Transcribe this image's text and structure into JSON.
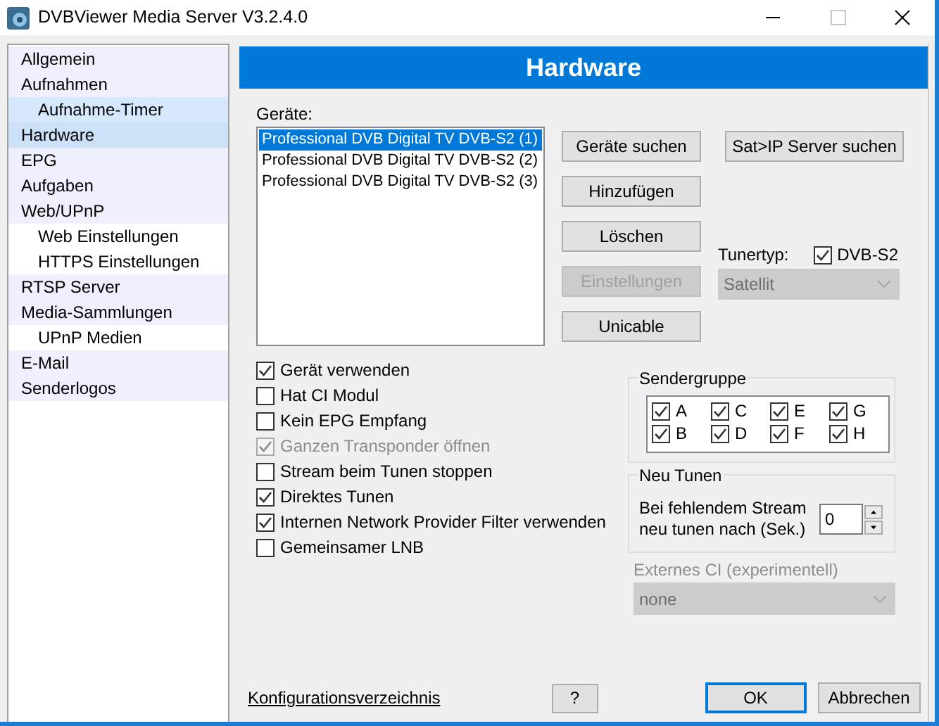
{
  "window": {
    "title": "DVBViewer Media Server V3.2.4.0",
    "maximize_enabled": false
  },
  "sidebar": {
    "items": [
      {
        "label": "Allgemein",
        "selected": false,
        "hovered": false
      },
      {
        "label": "Aufnahmen",
        "selected": false,
        "hovered": false,
        "children": [
          {
            "label": "Aufnahme-Timer",
            "selected": false,
            "hovered": true
          }
        ]
      },
      {
        "label": "Hardware",
        "selected": true,
        "hovered": false
      },
      {
        "label": "EPG",
        "selected": false,
        "hovered": false
      },
      {
        "label": "Aufgaben",
        "selected": false,
        "hovered": false
      },
      {
        "label": "Web/UPnP",
        "selected": false,
        "hovered": false,
        "children": [
          {
            "label": "Web Einstellungen",
            "selected": false,
            "hovered": false
          },
          {
            "label": "HTTPS Einstellungen",
            "selected": false,
            "hovered": false
          }
        ]
      },
      {
        "label": "RTSP Server",
        "selected": false,
        "hovered": false
      },
      {
        "label": "Media-Sammlungen",
        "selected": false,
        "hovered": false,
        "children": [
          {
            "label": "UPnP Medien",
            "selected": false,
            "hovered": false
          }
        ]
      },
      {
        "label": "E-Mail",
        "selected": false,
        "hovered": false
      },
      {
        "label": "Senderlogos",
        "selected": false,
        "hovered": false
      }
    ]
  },
  "page_title": "Hardware",
  "devices": {
    "label": "Geräte:",
    "items": [
      {
        "text": "Professional DVB Digital TV DVB-S2 (1)",
        "selected": true
      },
      {
        "text": "Professional DVB Digital TV DVB-S2 (2)",
        "selected": false
      },
      {
        "text": "Professional DVB Digital TV DVB-S2 (3)",
        "selected": false
      }
    ]
  },
  "device_buttons": [
    {
      "label": "Geräte suchen",
      "disabled": false
    },
    {
      "label": "Hinzufügen",
      "disabled": false
    },
    {
      "label": "Löschen",
      "disabled": false
    },
    {
      "label": "Einstellungen",
      "disabled": true
    },
    {
      "label": "Unicable",
      "disabled": false
    }
  ],
  "sat_ip_button": {
    "label": "Sat>IP Server suchen"
  },
  "tuner": {
    "label": "Tunertyp:",
    "dvb_s2": {
      "label": "DVB-S2",
      "checked": true
    },
    "select": {
      "value": "Satellit",
      "disabled": true
    }
  },
  "options": [
    {
      "label": "Gerät verwenden",
      "checked": true,
      "disabled": false
    },
    {
      "label": "Hat CI Modul",
      "checked": false,
      "disabled": false
    },
    {
      "label": "Kein EPG Empfang",
      "checked": false,
      "disabled": false
    },
    {
      "label": "Ganzen Transponder öffnen",
      "checked": true,
      "disabled": true
    },
    {
      "label": "Stream beim Tunen stoppen",
      "checked": false,
      "disabled": false
    },
    {
      "label": "Direktes Tunen",
      "checked": true,
      "disabled": false
    },
    {
      "label": "Internen Network Provider Filter verwenden",
      "checked": true,
      "disabled": false
    },
    {
      "label": "Gemeinsamer LNB",
      "checked": false,
      "disabled": false
    }
  ],
  "sendergruppe": {
    "title": "Sendergruppe",
    "groups": [
      {
        "label": "A",
        "checked": true
      },
      {
        "label": "C",
        "checked": true
      },
      {
        "label": "E",
        "checked": true
      },
      {
        "label": "G",
        "checked": true
      },
      {
        "label": "B",
        "checked": true
      },
      {
        "label": "D",
        "checked": true
      },
      {
        "label": "F",
        "checked": true
      },
      {
        "label": "H",
        "checked": true
      }
    ]
  },
  "neu_tunen": {
    "title": "Neu Tunen",
    "label_lines": [
      "Bei fehlendem Stream",
      "neu tunen nach (Sek.)"
    ],
    "value": "0"
  },
  "externes_ci": {
    "label": "Externes CI (experimentell)",
    "value": "none",
    "disabled": true
  },
  "footer": {
    "link": "Konfigurationsverzeichnis",
    "help": "?",
    "ok": {
      "label": "OK",
      "default": true
    },
    "cancel": {
      "label": "Abbrechen",
      "default": false
    }
  }
}
